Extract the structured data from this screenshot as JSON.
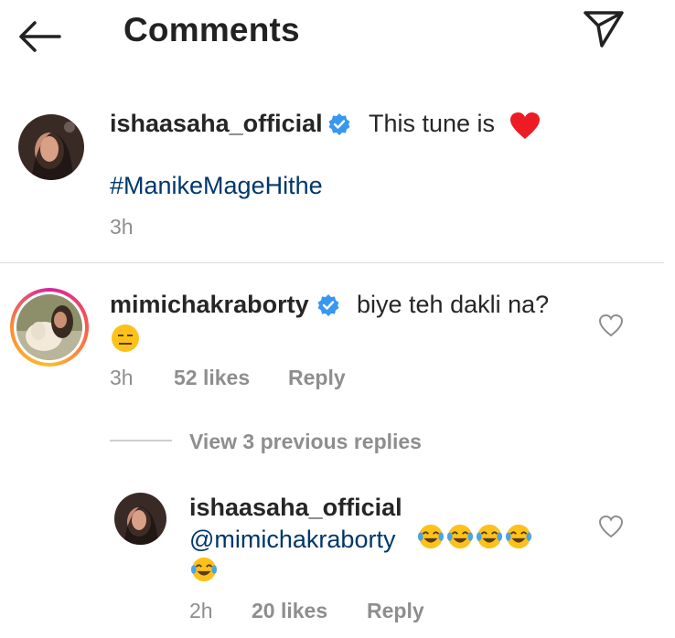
{
  "header": {
    "title": "Comments",
    "back_icon": "back-arrow-icon",
    "send_icon": "paper-plane-icon"
  },
  "caption": {
    "username": "ishaasaha_official",
    "text": "This tune is",
    "emoji": "❤️",
    "hashtag": "#ManikeMageHithe",
    "time": "3h"
  },
  "comment": {
    "username": "mimichakraborty",
    "text": "biye teh dakli na?",
    "emoji": "😑",
    "time": "3h",
    "likes": "52 likes",
    "reply_label": "Reply"
  },
  "view_replies": "View 3 previous replies",
  "reply": {
    "username": "ishaasaha_official",
    "mention": "@mimichakraborty",
    "emoji_count": 5,
    "emoji": "😂",
    "time": "2h",
    "likes": "20 likes",
    "reply_label": "Reply"
  },
  "colors": {
    "verified_blue": "#3897f0",
    "link_blue": "#00376b",
    "meta_gray": "#8e8e8e",
    "heart_red": "#ed1c24"
  }
}
